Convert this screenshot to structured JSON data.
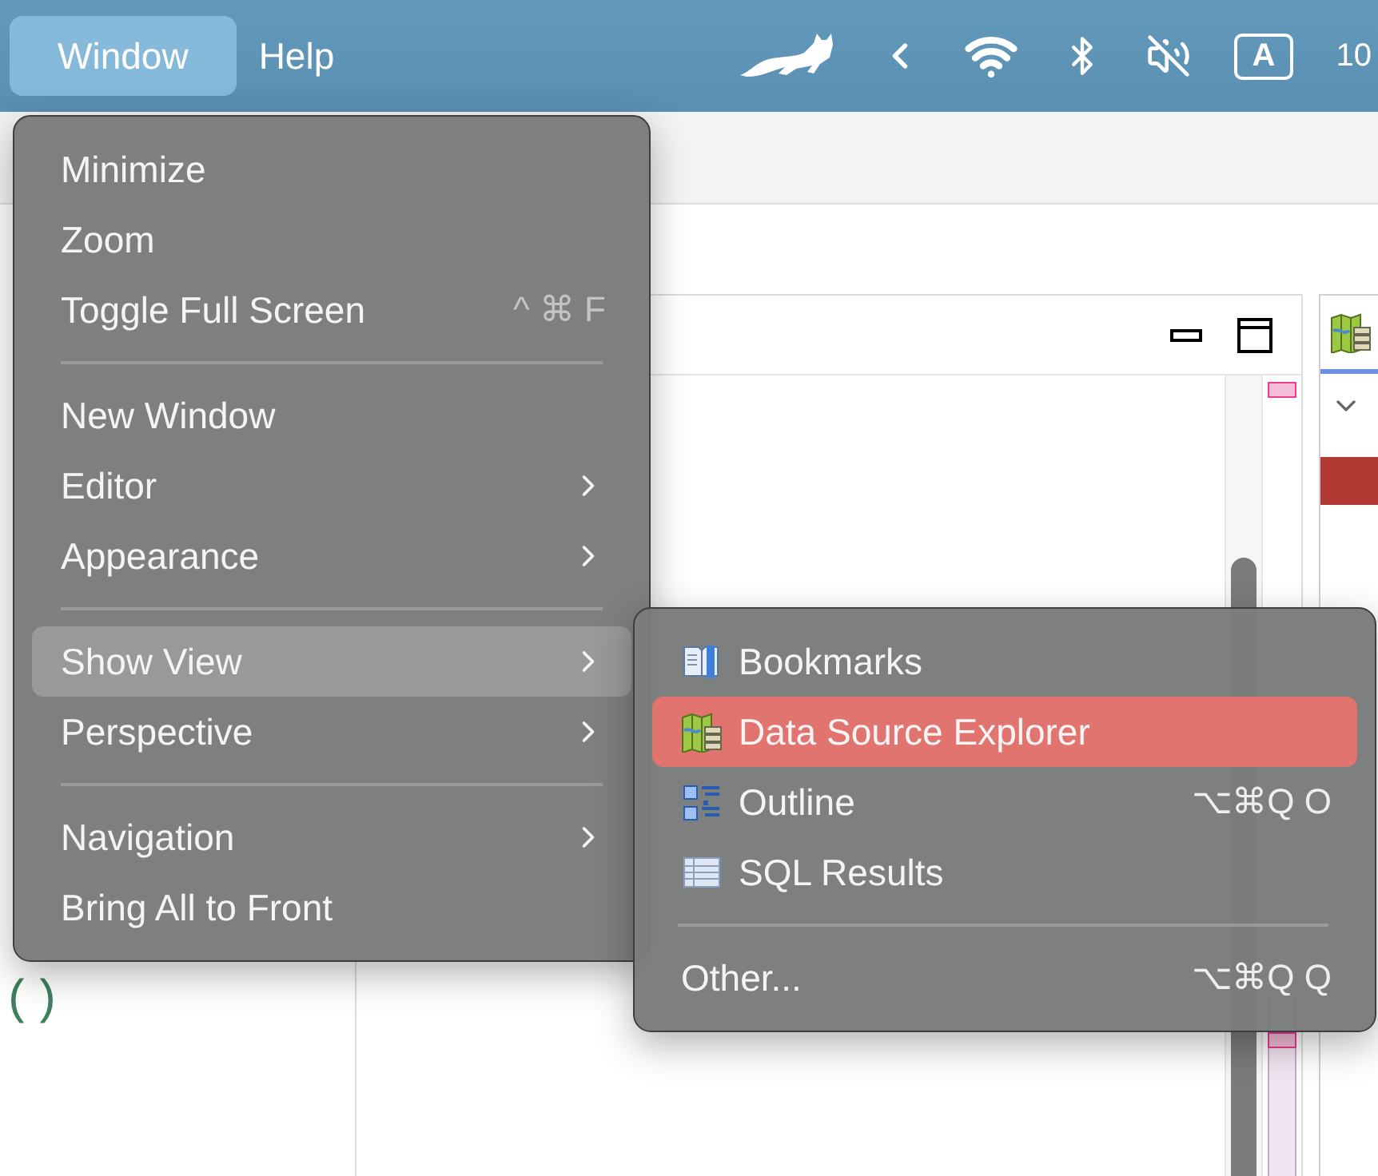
{
  "menu_bar": {
    "items": [
      {
        "label": "Window",
        "selected": true
      },
      {
        "label": "Help",
        "selected": false
      }
    ],
    "status": {
      "keyboard": "A",
      "clock": "10"
    }
  },
  "editor": {
    "code": "()"
  },
  "window_menu": {
    "items": [
      {
        "kind": "item",
        "label": "Minimize"
      },
      {
        "kind": "item",
        "label": "Zoom"
      },
      {
        "kind": "item",
        "label": "Toggle Full Screen",
        "shortcut": "^ ⌘ F"
      },
      {
        "kind": "separator"
      },
      {
        "kind": "item",
        "label": "New Window"
      },
      {
        "kind": "submenu",
        "label": "Editor",
        "selected": false
      },
      {
        "kind": "submenu",
        "label": "Appearance",
        "selected": false
      },
      {
        "kind": "separator"
      },
      {
        "kind": "submenu",
        "label": "Show View",
        "selected": true
      },
      {
        "kind": "submenu",
        "label": "Perspective",
        "selected": false
      },
      {
        "kind": "separator"
      },
      {
        "kind": "submenu",
        "label": "Navigation",
        "selected": false
      },
      {
        "kind": "item",
        "label": "Bring All to Front"
      }
    ]
  },
  "show_view_menu": {
    "items": [
      {
        "kind": "view",
        "label": "Bookmarks",
        "selected": false
      },
      {
        "kind": "view",
        "label": "Data Source Explorer",
        "selected": true
      },
      {
        "kind": "view",
        "label": "Outline",
        "shortcut": "⌥⌘Q O",
        "selected": false
      },
      {
        "kind": "view",
        "label": "SQL Results",
        "selected": false
      },
      {
        "kind": "separator"
      },
      {
        "kind": "item",
        "label": "Other...",
        "shortcut": "⌥⌘Q Q"
      }
    ]
  }
}
